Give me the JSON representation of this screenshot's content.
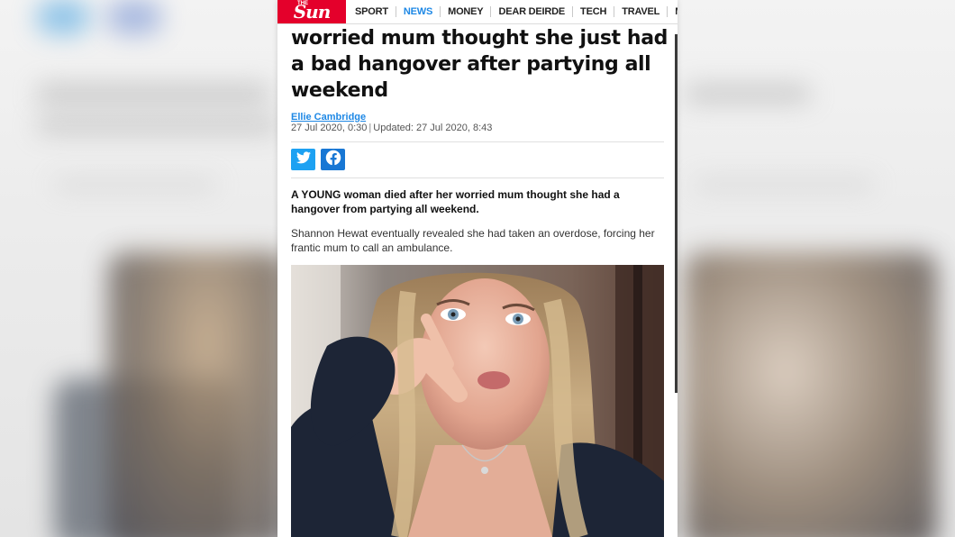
{
  "nav": {
    "logo_small": "THE",
    "logo": "Sun",
    "items": [
      {
        "label": "SPORT",
        "active": false
      },
      {
        "label": "NEWS",
        "active": true
      },
      {
        "label": "MONEY",
        "active": false
      },
      {
        "label": "DEAR DEIRDE",
        "active": false
      },
      {
        "label": "TECH",
        "active": false
      },
      {
        "label": "TRAVEL",
        "active": false
      },
      {
        "label": "MOT",
        "active": false
      }
    ]
  },
  "article": {
    "headline": "worried mum thought she just had a bad hangover after partying all weekend",
    "author": "Ellie Cambridge",
    "published": "27 Jul 2020, 0:30",
    "separator": "|",
    "updated": "Updated: 27 Jul 2020, 8:43",
    "lede": "A YOUNG woman died after her worried mum thought she had a hangover from partying all weekend.",
    "body": "Shannon Hewat eventually revealed she had taken an overdose, forcing her frantic mum to call an ambulance."
  },
  "share": {
    "twitter_icon": "twitter-icon",
    "facebook_icon": "facebook-icon"
  },
  "colors": {
    "brand": "#e4002b",
    "accent": "#1e88e5",
    "twitter": "#1da1f2",
    "facebook": "#1877d4"
  }
}
